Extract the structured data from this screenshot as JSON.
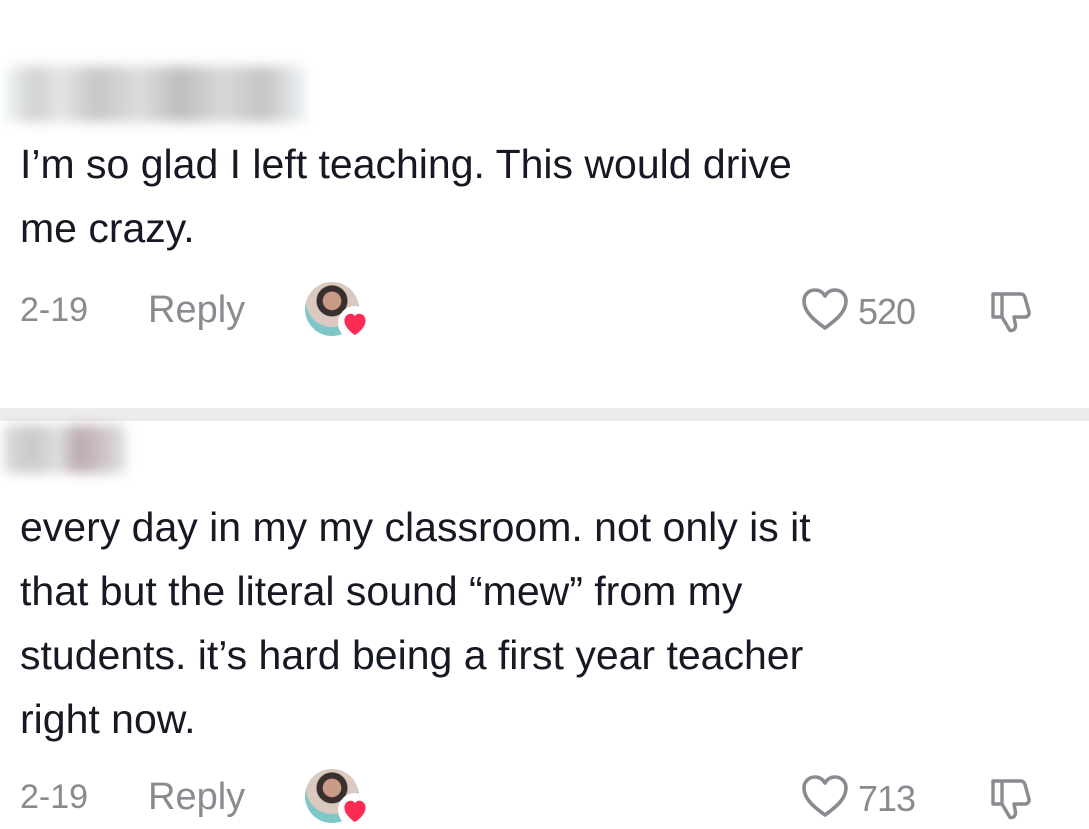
{
  "comments": [
    {
      "text": "I’m so glad I left teaching. This would drive\nme crazy.",
      "date": "2-19",
      "reply_label": "Reply",
      "like_count": "520",
      "icons": {
        "like": "heart-outline-icon",
        "dislike": "thumbs-down-icon",
        "creator_liked": "creator-avatar-heart-icon"
      }
    },
    {
      "text": "every day in my my classroom. not only is it\nthat but the literal sound “mew” from my\nstudents. it’s hard being a first year teacher\nright now.",
      "date": "2-19",
      "reply_label": "Reply",
      "like_count": "713",
      "icons": {
        "like": "heart-outline-icon",
        "dislike": "thumbs-down-icon",
        "creator_liked": "creator-avatar-heart-icon"
      }
    }
  ],
  "colors": {
    "text": "#161823",
    "meta": "#8a8b91",
    "separator": "#ececec",
    "creator_heart": "#fe2c55"
  }
}
